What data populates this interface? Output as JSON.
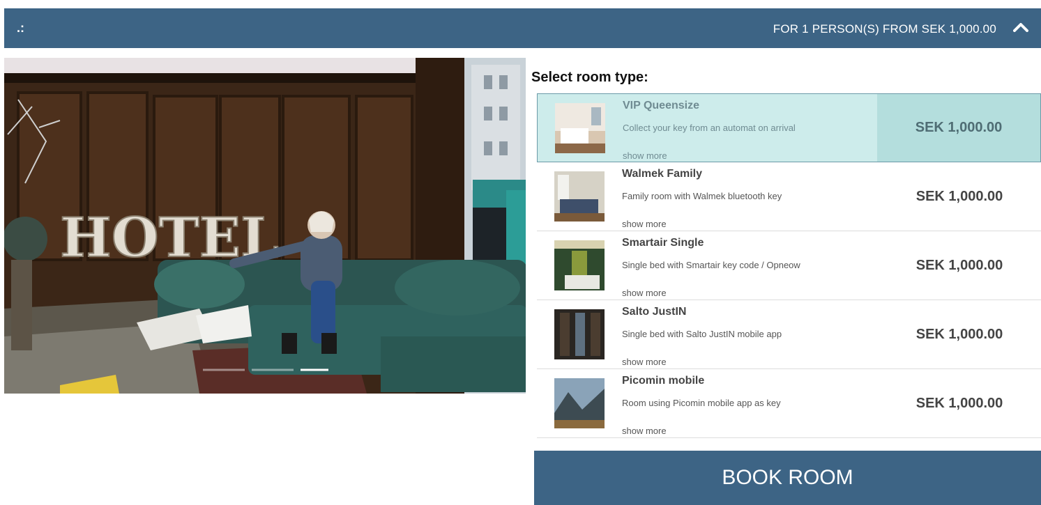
{
  "header": {
    "menu_glyph": ".:",
    "summary": "FOR 1 PERSON(S) FROM SEK 1,000.00",
    "collapse_icon": "chevron-up-icon"
  },
  "hero": {
    "sign_text": "HOTEL"
  },
  "rooms_title": "Select room type:",
  "rooms": [
    {
      "name": "VIP Queensize",
      "description": "Collect your key from an automat on arrival",
      "show_more": "show more",
      "price": "SEK 1,000.00",
      "selected": true
    },
    {
      "name": "Walmek Family",
      "description": "Family room with Walmek bluetooth key",
      "show_more": "show more",
      "price": "SEK 1,000.00",
      "selected": false
    },
    {
      "name": "Smartair Single",
      "description": "Single bed with Smartair key code / Opneow",
      "show_more": "show more",
      "price": "SEK 1,000.00",
      "selected": false
    },
    {
      "name": "Salto JustIN",
      "description": "Single bed with Salto JustIN mobile app",
      "show_more": "show more",
      "price": "SEK 1,000.00",
      "selected": false
    },
    {
      "name": "Picomin mobile",
      "description": "Room using Picomin mobile app as key",
      "show_more": "show more",
      "price": "SEK 1,000.00",
      "selected": false
    }
  ],
  "book_button": "BOOK ROOM",
  "colors": {
    "brand": "#3d6485",
    "selected_row": "#cdeceb",
    "selected_price_cell": "#b4dedd"
  }
}
